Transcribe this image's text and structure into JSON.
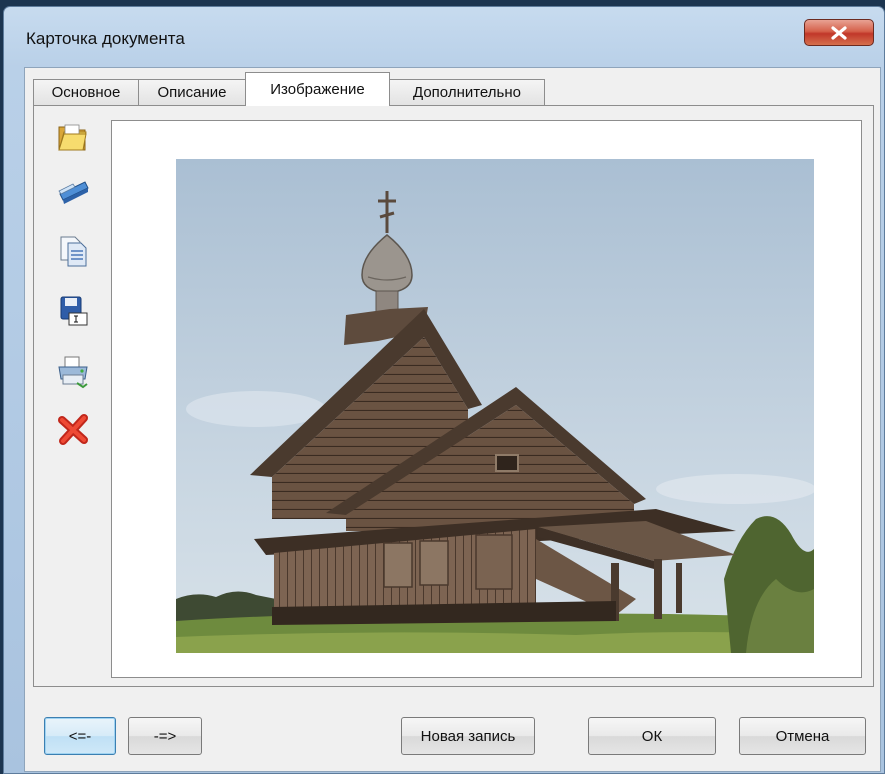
{
  "window": {
    "title": "Карточка документа"
  },
  "tabs": [
    {
      "label": "Основное",
      "active": false
    },
    {
      "label": "Описание",
      "active": false
    },
    {
      "label": "Изображение",
      "active": true
    },
    {
      "label": "Дополнительно",
      "active": false
    }
  ],
  "toolbar": {
    "icons": [
      "open-folder-icon",
      "scanner-icon",
      "copy-icon",
      "save-icon",
      "print-icon",
      "delete-icon"
    ]
  },
  "buttons": {
    "prev": "<=-",
    "next": "-=>",
    "new_record": "Новая запись",
    "ok": "ОК",
    "cancel": "Отмена"
  },
  "colors": {
    "close_button": "#c1372a",
    "focus_border": "#3c7fb1"
  }
}
